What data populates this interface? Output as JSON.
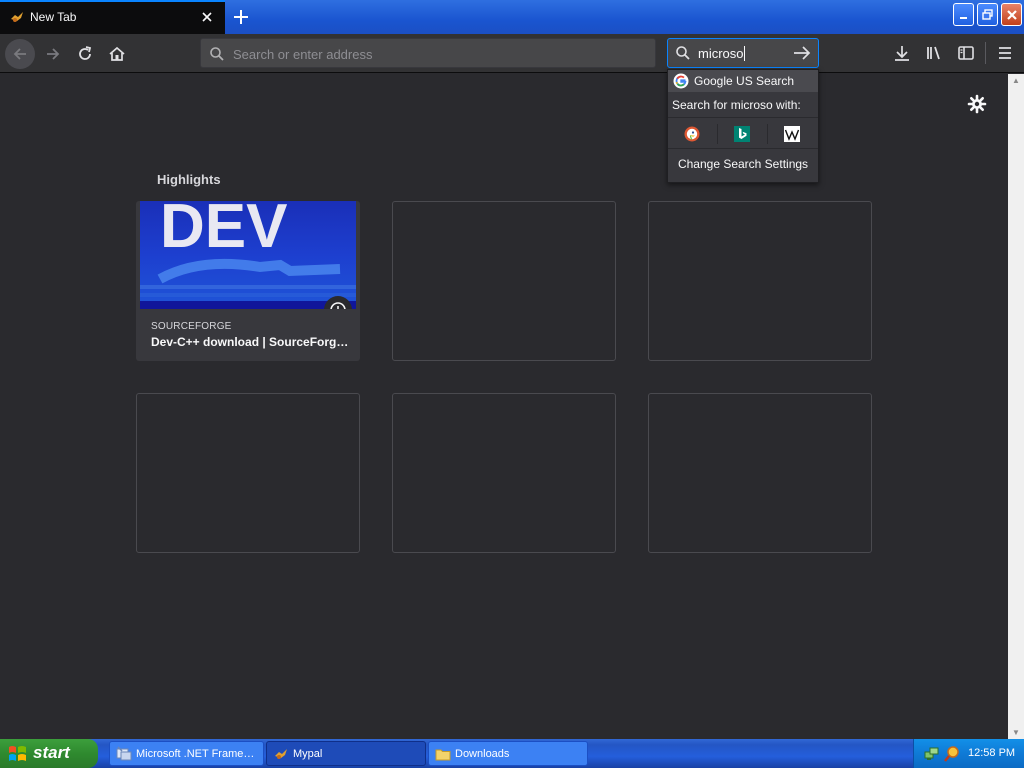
{
  "window": {
    "tab_title": "New Tab",
    "close_tab_label": "Close tab",
    "new_tab_label": "New tab"
  },
  "navbar": {
    "address_placeholder": "Search or enter address",
    "search_value": "microso",
    "icons": [
      "back-icon",
      "forward-icon",
      "reload-icon",
      "home-icon",
      "downloads-icon",
      "library-icon",
      "sidebar-icon",
      "menu-icon"
    ]
  },
  "search_popup": {
    "engine_label": "Google US Search",
    "search_for_label": "Search for microso with:",
    "engines": [
      "duckduckgo-icon",
      "bing-icon",
      "wikipedia-icon"
    ],
    "change_settings_label": "Change Search Settings"
  },
  "content": {
    "section_title": "Highlights",
    "highlights": [
      {
        "host": "SOURCEFORGE",
        "title": "Dev-C++ download | SourceForg…"
      }
    ]
  },
  "taskbar": {
    "start_label": "start",
    "tasks": [
      {
        "label": "Microsoft .NET Frame…"
      },
      {
        "label": "Mypal"
      },
      {
        "label": "Downloads"
      }
    ],
    "clock": "12:58 PM"
  },
  "colors": {
    "accent": "#0a84ff",
    "page_bg": "#2a2a2e",
    "toolbar_bg": "#323234",
    "xp_blue": "#245edc",
    "xp_green": "#2f8a2f"
  }
}
